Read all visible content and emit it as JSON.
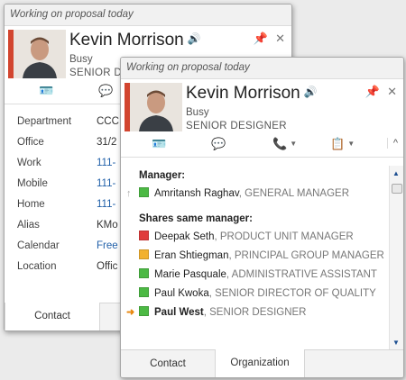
{
  "back_card": {
    "note": "Working on proposal today",
    "name": "Kevin Morrison",
    "status": "Busy",
    "title": "SENIOR DE",
    "fields": [
      {
        "label": "Department",
        "value": "CCC",
        "link": false
      },
      {
        "label": "Office",
        "value": "31/2",
        "link": false
      },
      {
        "label": "Work",
        "value": "111-",
        "link": true
      },
      {
        "label": "Mobile",
        "value": "111-",
        "link": true
      },
      {
        "label": "Home",
        "value": "111-",
        "link": true
      },
      {
        "label": "Alias",
        "value": "KMo",
        "link": false
      },
      {
        "label": "Calendar",
        "value": "Free",
        "link": true
      },
      {
        "label": "Location",
        "value": "Offic",
        "link": false
      }
    ],
    "tabs": [
      "Contact",
      "O"
    ]
  },
  "front_card": {
    "note": "Working on proposal today",
    "name": "Kevin Morrison",
    "status": "Busy",
    "title": "SENIOR DESIGNER",
    "manager_heading": "Manager:",
    "manager": {
      "name": "Amritansh Raghav",
      "role": ", GENERAL MANAGER",
      "presence": "#4cb944"
    },
    "peers_heading": "Shares same manager:",
    "peers": [
      {
        "name": "Deepak Seth",
        "role": ", PRODUCT UNIT MANAGER",
        "presence": "#e03c3c"
      },
      {
        "name": "Eran Shtiegman",
        "role": ", PRINCIPAL GROUP MANAGER",
        "presence": "#f2b12e"
      },
      {
        "name": "Marie Pasquale",
        "role": ", ADMINISTRATIVE ASSISTANT",
        "presence": "#4cb944"
      },
      {
        "name": "Paul Kwoka",
        "role": ", SENIOR DIRECTOR OF QUALITY",
        "presence": "#4cb944"
      },
      {
        "name": "Paul West",
        "role": ", SENIOR DESIGNER",
        "presence": "#4cb944"
      }
    ],
    "tabs": [
      "Contact",
      "Organization"
    ]
  },
  "icons": {
    "speaker": "🔊",
    "pin": "📌",
    "close": "✕",
    "card": "🪪",
    "im": "💬",
    "phone": "📞",
    "meeting": "📋",
    "collapse": "^",
    "up_arrow": "↑",
    "you_arrow": "➜"
  },
  "accent_color": "#d2452f"
}
